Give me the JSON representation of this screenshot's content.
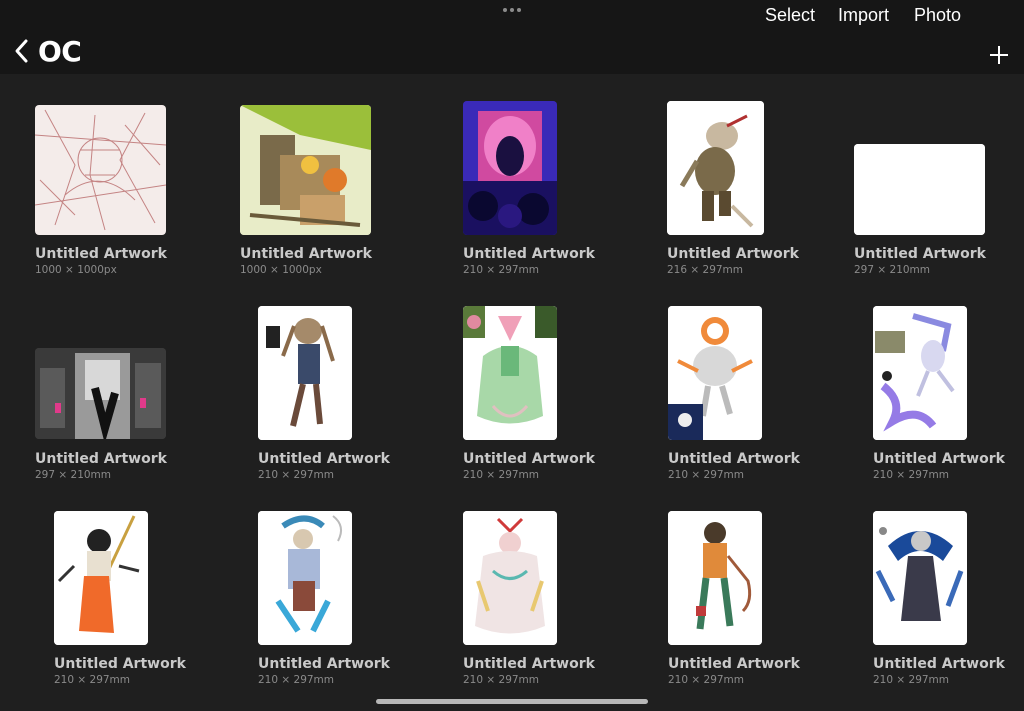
{
  "header": {
    "title": "OC",
    "actions": {
      "select": "Select",
      "import": "Import",
      "photo": "Photo"
    }
  },
  "artworks": [
    {
      "title": "Untitled Artwork",
      "size": "1000 × 1000px"
    },
    {
      "title": "Untitled Artwork",
      "size": "1000 × 1000px"
    },
    {
      "title": "Untitled Artwork",
      "size": "210 × 297mm"
    },
    {
      "title": "Untitled Artwork",
      "size": "216 × 297mm"
    },
    {
      "title": "Untitled Artwork",
      "size": "297 × 210mm"
    },
    {
      "title": "Untitled Artwork",
      "size": "297 × 210mm"
    },
    {
      "title": "Untitled Artwork",
      "size": "210 × 297mm"
    },
    {
      "title": "Untitled Artwork",
      "size": "210 × 297mm"
    },
    {
      "title": "Untitled Artwork",
      "size": "210 × 297mm"
    },
    {
      "title": "Untitled Artwork",
      "size": "210 × 297mm"
    },
    {
      "title": "Untitled Artwork",
      "size": "210 × 297mm"
    },
    {
      "title": "Untitled Artwork",
      "size": "210 × 297mm"
    },
    {
      "title": "Untitled Artwork",
      "size": "210 × 297mm"
    },
    {
      "title": "Untitled Artwork",
      "size": "210 × 297mm"
    },
    {
      "title": "Untitled Artwork",
      "size": "210 × 297mm"
    }
  ],
  "colors": {
    "background": "#1f1f1f",
    "topbar": "#161616",
    "title_text": "#c9c9c9",
    "size_text": "#8a8a8a"
  }
}
